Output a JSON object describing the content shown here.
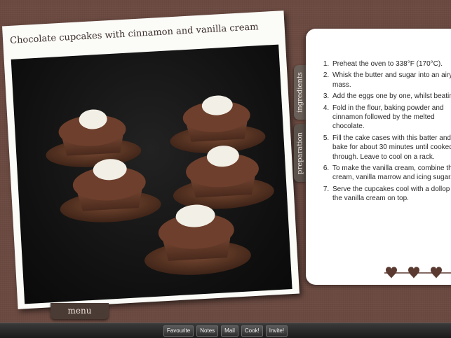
{
  "recipe": {
    "title": "Chocolate cupcakes with cinnamon and vanilla cream",
    "photo_icon": "cupcakes-photo"
  },
  "tabs": {
    "ingredients": "ingredients",
    "preparation": "preparation"
  },
  "steps": [
    "Preheat the oven to 338°F (170°C).",
    "Whisk the butter and sugar into an airy mass.",
    "Add the eggs one by one, whilst beating.",
    "Fold in the flour, baking powder and cinnamon followed by the melted chocolate.",
    "Fill the cake cases with this batter and bake for about 30 minutes until cooked through. Leave to cool on a rack.",
    "To make the vanilla cream, combine the cream, vanilla marrow and icing sugar.",
    "Serve the cupcakes cool with a dollop of the vanilla cream on top."
  ],
  "rating_icon": "hearts-icon",
  "menu_label": "menu",
  "toolbar": {
    "favourite": "Favourite",
    "notes": "Notes",
    "mail": "Mail",
    "cook": "Cook!",
    "invite": "Invite!"
  },
  "colors": {
    "background": "#6b4a41",
    "heart": "#5a3a30",
    "tab": "#6a5f58"
  }
}
